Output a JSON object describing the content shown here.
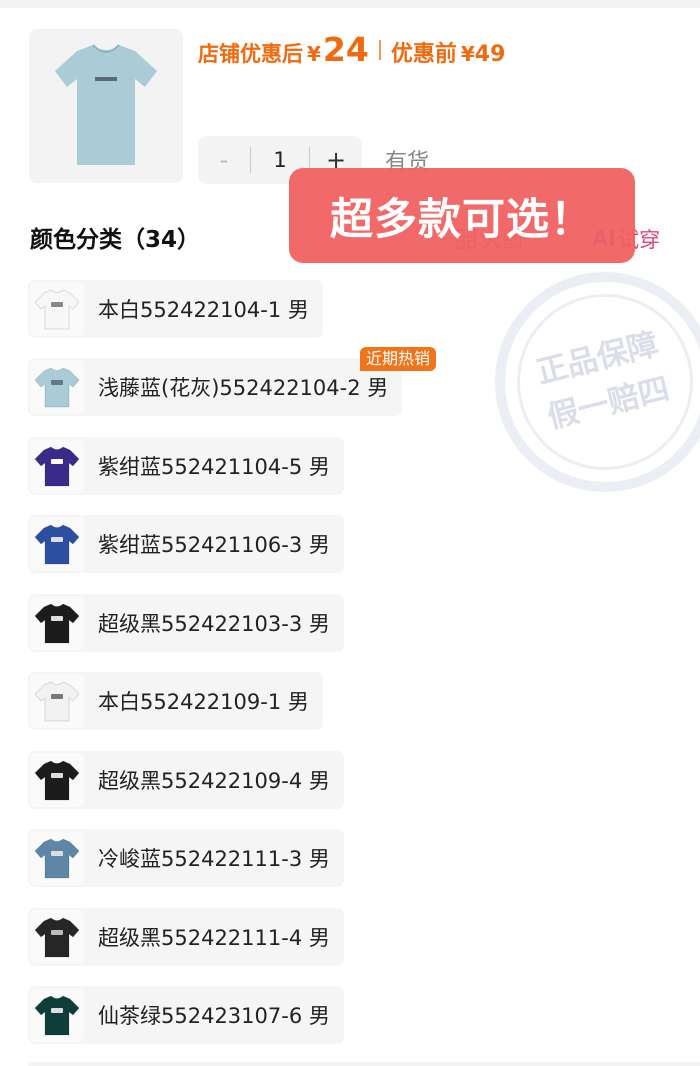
{
  "product": {
    "price_after_label": "店铺优惠后",
    "price_after_currency": "¥",
    "price_after_value": "24",
    "price_before_label": "优惠前",
    "price_before_currency": "¥",
    "price_before_value": "49",
    "thumb_color": "#a9ccd6",
    "accent_color": "#f06a0f"
  },
  "quantity": {
    "minus": "-",
    "value": "1",
    "plus": "+",
    "stock_status": "有货"
  },
  "section": {
    "title": "颜色分类（34）",
    "big_image_label": "大图",
    "ai_label": "AI",
    "tryon_label": "试穿"
  },
  "overlay": {
    "text": "超多款可选！"
  },
  "watermark": {
    "line1": "正品保障",
    "line2": "假一赔四"
  },
  "hot_tag": "近期热销",
  "variants": [
    {
      "label": "本白552422104-1 男",
      "shirt_color": "#f7f7f7",
      "print_color": "#888888"
    },
    {
      "label": "浅藤蓝(花灰)552422104-2 男",
      "shirt_color": "#a9ccd6",
      "print_color": "#667788"
    },
    {
      "label": "紫绀蓝552421104-5 男",
      "shirt_color": "#3a2a8a",
      "print_color": "#ffffff"
    },
    {
      "label": "紫绀蓝552421106-3 男",
      "shirt_color": "#2c4fa3",
      "print_color": "#dddddd"
    },
    {
      "label": "超级黑552422103-3 男",
      "shirt_color": "#1c1c1c",
      "print_color": "#dddddd"
    },
    {
      "label": "本白552422109-1 男",
      "shirt_color": "#f2f2f2",
      "print_color": "#777777"
    },
    {
      "label": "超级黑552422109-4 男",
      "shirt_color": "#1c1c1c",
      "print_color": "#dddddd"
    },
    {
      "label": "冷峻蓝552422111-3 男",
      "shirt_color": "#5e86a6",
      "print_color": "#dddddd"
    },
    {
      "label": "超级黑552422111-4 男",
      "shirt_color": "#262626",
      "print_color": "#bbbbbb"
    },
    {
      "label": "仙茶绿552423107-6 男",
      "shirt_color": "#0f3d3a",
      "print_color": "#dddddd"
    }
  ]
}
